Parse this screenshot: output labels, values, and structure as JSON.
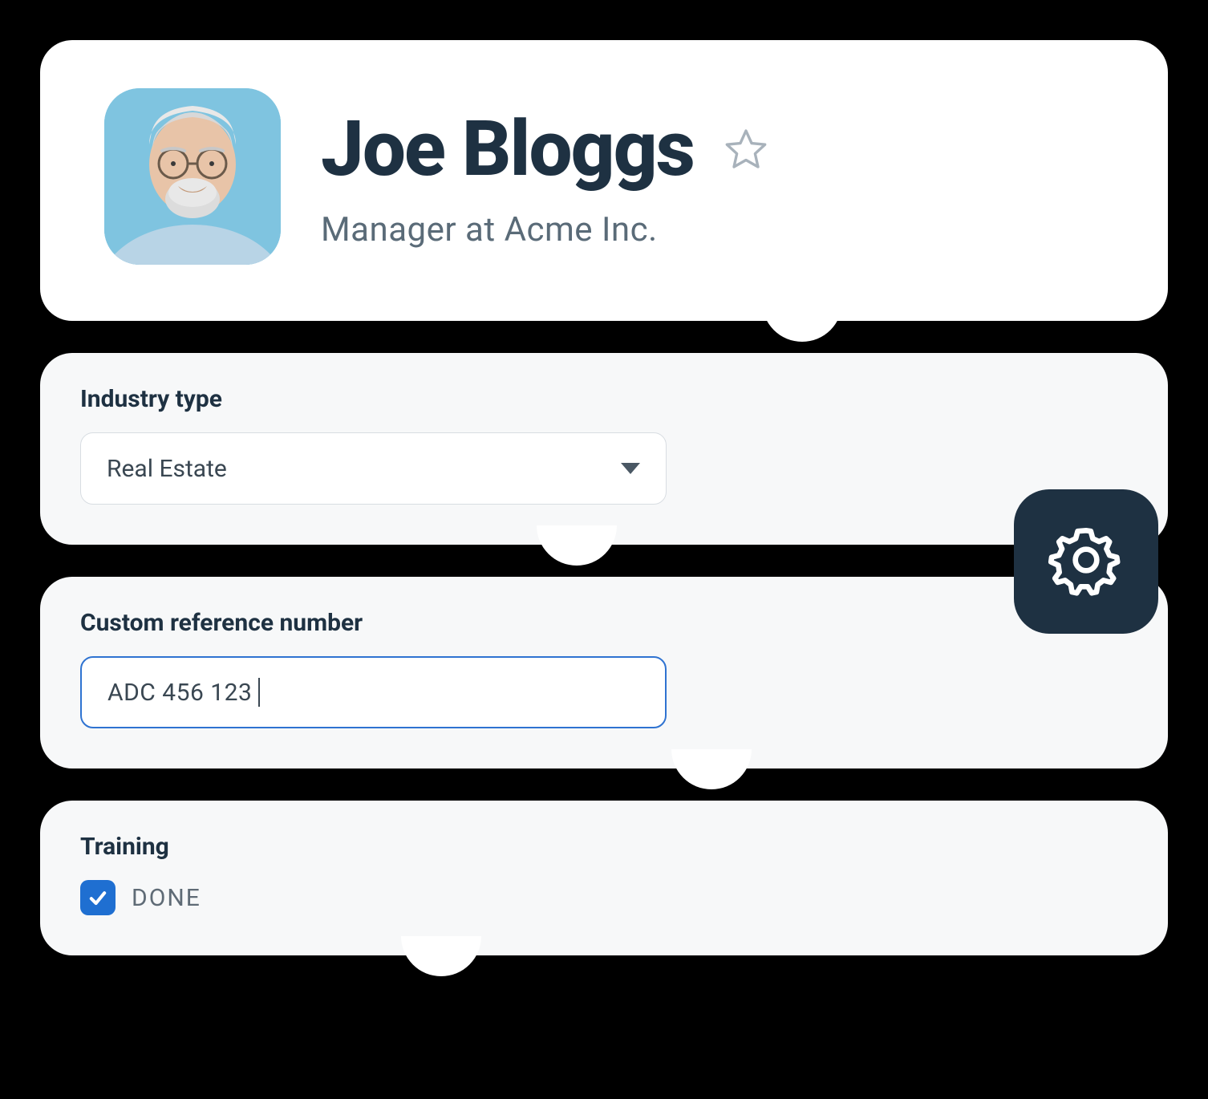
{
  "profile": {
    "name": "Joe Bloggs",
    "subtitle": "Manager at Acme Inc."
  },
  "fields": {
    "industry": {
      "label": "Industry type",
      "value": "Real Estate"
    },
    "reference": {
      "label": "Custom reference number",
      "value": "ADC 456 123"
    },
    "training": {
      "label": "Training",
      "status": "DONE",
      "checked": true
    }
  },
  "colors": {
    "text_dark": "#1e3142",
    "text_muted": "#5a6b78",
    "field_bg": "#f7f8f9",
    "accent_blue": "#1f6fd1",
    "focus_border": "#2f73d1"
  }
}
